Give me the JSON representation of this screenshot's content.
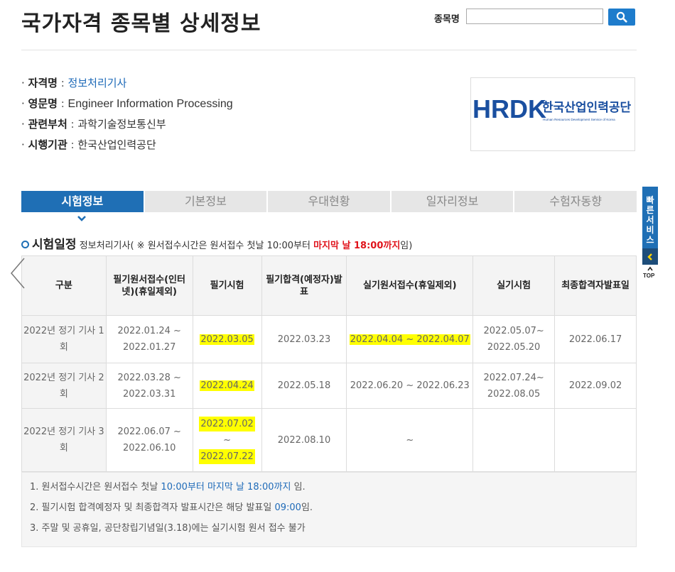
{
  "header": {
    "title": "국가자격 종목별 상세정보",
    "search_label": "종목명",
    "search_value": "",
    "search_placeholder": ""
  },
  "info": [
    {
      "label": "자격명",
      "sep": " : ",
      "value": "정보처리기사",
      "style": "link"
    },
    {
      "label": "영문명",
      "sep": " : ",
      "value": "Engineer Information Processing",
      "style": "en"
    },
    {
      "label": "관련부처",
      "sep": " : ",
      "value": "과학기술정보통신부",
      "style": ""
    },
    {
      "label": "시행기관",
      "sep": " : ",
      "value": "한국산업인력공단",
      "style": ""
    }
  ],
  "logo": {
    "brand": "HRDK",
    "name_ko": "한국산업인력공단",
    "name_en": "Human Resources Development Service of Korea"
  },
  "tabs": [
    "시험정보",
    "기본정보",
    "우대현황",
    "일자리정보",
    "수험자동향"
  ],
  "active_tab": 0,
  "schedule": {
    "title": "시험일정",
    "subtitle_pre": "정보처리기사( ※ 원서접수시간은 원서접수 첫날 10:00부터 ",
    "subtitle_red": "마지막 날 18:00까지",
    "subtitle_post": "임)",
    "columns": [
      "구분",
      "필기원서접수(인터넷)(휴일제외)",
      "필기시험",
      "필기합격(예정자)발표",
      "실기원서접수(휴일제외)",
      "실기시험",
      "최종합격자발표일"
    ],
    "rows": [
      {
        "label": "2022년 정기 기사 1회",
        "written_apply": "2022.01.24 ~ 2022.01.27",
        "written_exam": "2022.03.05",
        "written_result": "2022.03.23",
        "practical_apply": "2022.04.04 ~ 2022.04.07",
        "practical_exam": "2022.05.07~ 2022.05.20",
        "final": "2022.06.17"
      },
      {
        "label": "2022년 정기 기사 2회",
        "written_apply": "2022.03.28 ~ 2022.03.31",
        "written_exam": "2022.04.24",
        "written_result": "2022.05.18",
        "practical_apply": "2022.06.20 ~ 2022.06.23",
        "practical_exam": "2022.07.24~ 2022.08.05",
        "final": "2022.09.02"
      },
      {
        "label": "2022년 정기 기사 3회",
        "written_apply": "2022.06.07 ~ 2022.06.10",
        "written_exam_start": "2022.07.02",
        "written_exam_sep": "~",
        "written_exam_end": "2022.07.22",
        "written_result": "2022.08.10",
        "practical_apply": "~",
        "practical_exam": "",
        "final": ""
      }
    ]
  },
  "notes": [
    {
      "pre": "1. 원서접수시간은 원서접수 첫날 ",
      "blue": "10:00부터 마지막 날 18:00까지",
      "post": " 임."
    },
    {
      "pre": "2. 필기시험 합격예정자 및 최종합격자 발표시간은 해당 발표일 ",
      "blue": "09:00",
      "post": "임."
    },
    {
      "pre": "3. 주말 및 공휴일, 공단창립기념일(3.18)에는 실기시험 원서 접수 불가",
      "blue": "",
      "post": ""
    }
  ],
  "side": {
    "quick_label": "빠른서비스",
    "top_label": "TOP"
  },
  "colors": {
    "primary": "#1f6fb5",
    "highlight": "#ffff00",
    "red": "#e0141c",
    "link": "#1e6ab8"
  }
}
